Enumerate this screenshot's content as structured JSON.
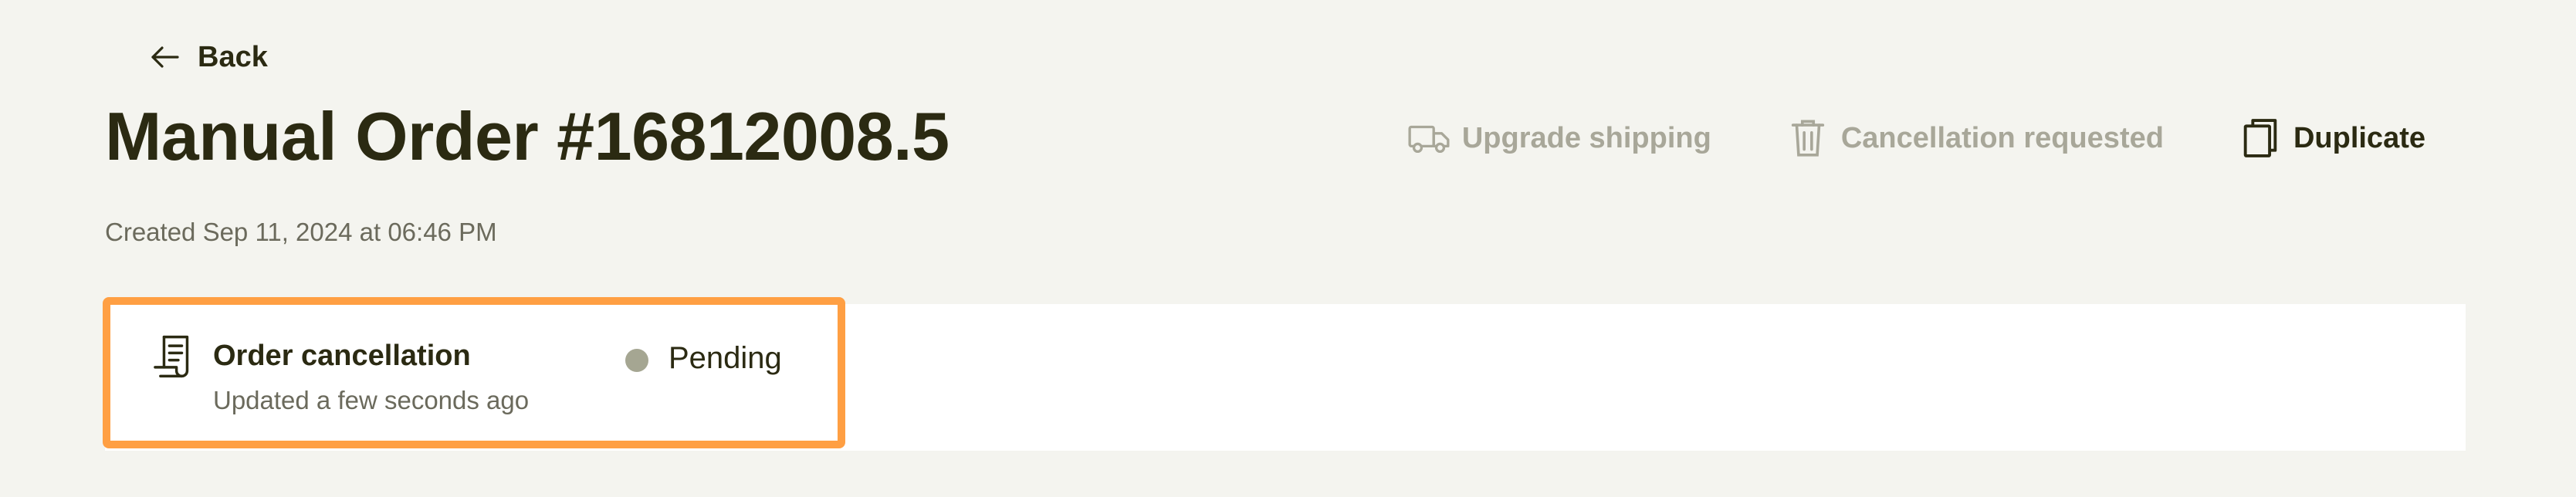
{
  "header": {
    "back_label": "Back",
    "title": "Manual Order #16812008.5",
    "created": "Created Sep 11, 2024 at 06:46 PM"
  },
  "actions": {
    "upgrade_shipping": {
      "label": "Upgrade shipping",
      "icon": "truck-icon",
      "enabled": false
    },
    "cancellation_requested": {
      "label": "Cancellation requested",
      "icon": "trash-icon",
      "enabled": false
    },
    "duplicate": {
      "label": "Duplicate",
      "icon": "copy-icon",
      "enabled": true
    }
  },
  "event": {
    "icon": "receipt-icon",
    "title": "Order cancellation",
    "subtitle": "Updated a few seconds ago",
    "status": "Pending",
    "status_color": "#a5a692"
  },
  "colors": {
    "background": "#f4f4ef",
    "text_primary": "#2b2a12",
    "text_muted": "#6b6a5c",
    "text_disabled": "#a8a799",
    "highlight": "#ff9f43"
  }
}
